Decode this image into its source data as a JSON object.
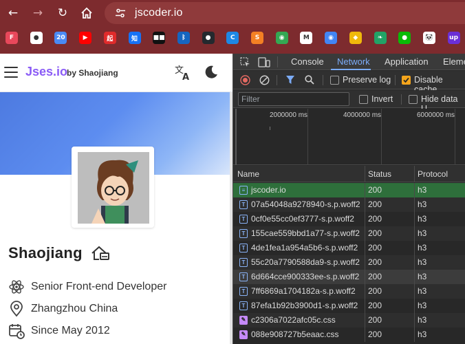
{
  "browser": {
    "url": "jscoder.io",
    "bookmarks": [
      {
        "icon": "figma-icon",
        "color": "#e8485b",
        "glyph": "F"
      },
      {
        "icon": "globe-icon",
        "color": "#ffffff",
        "glyph": "●"
      },
      {
        "icon": "calendar-icon",
        "color": "#4a8af4",
        "glyph": "20"
      },
      {
        "icon": "youtube-icon",
        "color": "#ff0000",
        "glyph": "▶"
      },
      {
        "icon": "app-icon",
        "color": "#e02b2b",
        "glyph": "起"
      },
      {
        "icon": "zhihu-icon",
        "color": "#1772f6",
        "glyph": "知"
      },
      {
        "icon": "dots-icon",
        "color": "#111111",
        "glyph": "■■"
      },
      {
        "icon": "bluetooth-icon",
        "color": "#1565c0",
        "glyph": "ᛒ"
      },
      {
        "icon": "github-icon",
        "color": "#24292e",
        "glyph": "●"
      },
      {
        "icon": "edge-icon",
        "color": "#1e88e5",
        "glyph": "C"
      },
      {
        "icon": "stackoverflow-icon",
        "color": "#f48024",
        "glyph": "S"
      },
      {
        "icon": "chrome-icon",
        "color": "#34a853",
        "glyph": "◉"
      },
      {
        "icon": "gmail-icon",
        "color": "#ffffff",
        "glyph": "M"
      },
      {
        "icon": "chrome2-icon",
        "color": "#4285f4",
        "glyph": "◉"
      },
      {
        "icon": "binance-icon",
        "color": "#f0b90b",
        "glyph": "◆"
      },
      {
        "icon": "leaf-icon",
        "color": "#21a366",
        "glyph": "❧"
      },
      {
        "icon": "wechat-icon",
        "color": "#09bb07",
        "glyph": "●"
      },
      {
        "icon": "panda-icon",
        "color": "#ffffff",
        "glyph": "🐼"
      },
      {
        "icon": "upwork-icon",
        "color": "#6b2fd6",
        "glyph": "up"
      }
    ]
  },
  "site": {
    "brand": "Jses.io",
    "byline": "by Shaojiang",
    "profile": {
      "name": "Shaojiang",
      "role": "Senior Front-end Developer",
      "location": "Zhangzhou China",
      "since": "Since May 2012"
    }
  },
  "devtools": {
    "tabs": [
      "Console",
      "Network",
      "Application",
      "Eleme"
    ],
    "active_tab": "Network",
    "toolbar": {
      "preserve_log": "Preserve log",
      "disable_cache": "Disable cache"
    },
    "filter": {
      "placeholder": "Filter",
      "invert": "Invert",
      "hide_data": "Hide data U"
    },
    "timeline_labels": [
      "2000000 ms",
      "4000000 ms",
      "6000000 ms"
    ],
    "columns": [
      "Name",
      "Status",
      "Protocol"
    ],
    "rows": [
      {
        "name": "jscoder.io",
        "status": "200",
        "protocol": "h3",
        "type": "doc"
      },
      {
        "name": "07a54048a9278940-s.p.woff2",
        "status": "200",
        "protocol": "h3",
        "type": "font"
      },
      {
        "name": "0cf0e55cc0ef3777-s.p.woff2",
        "status": "200",
        "protocol": "h3",
        "type": "font"
      },
      {
        "name": "155cae559bbd1a77-s.p.woff2",
        "status": "200",
        "protocol": "h3",
        "type": "font"
      },
      {
        "name": "4de1fea1a954a5b6-s.p.woff2",
        "status": "200",
        "protocol": "h3",
        "type": "font"
      },
      {
        "name": "55c20a7790588da9-s.p.woff2",
        "status": "200",
        "protocol": "h3",
        "type": "font"
      },
      {
        "name": "6d664cce900333ee-s.p.woff2",
        "status": "200",
        "protocol": "h3",
        "type": "font"
      },
      {
        "name": "7ff6869a1704182a-s.p.woff2",
        "status": "200",
        "protocol": "h3",
        "type": "font"
      },
      {
        "name": "87efa1b92b3900d1-s.p.woff2",
        "status": "200",
        "protocol": "h3",
        "type": "font"
      },
      {
        "name": "c2306a7022afc05c.css",
        "status": "200",
        "protocol": "h3",
        "type": "css"
      },
      {
        "name": "088e908727b5eaac.css",
        "status": "200",
        "protocol": "h3",
        "type": "css"
      }
    ],
    "colors": {
      "selected_row": "#2e6f3b",
      "network_tab": "#7cacf8",
      "checkbox_checked": "#f4a51c",
      "record": "#e46962"
    }
  }
}
